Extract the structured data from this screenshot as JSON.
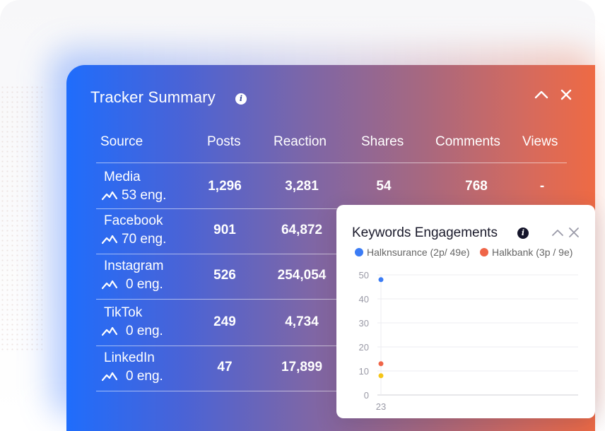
{
  "tracker": {
    "title": "Tracker Summary",
    "columns": [
      "Source",
      "Posts",
      "Reaction",
      "Shares",
      "Comments",
      "Views"
    ],
    "rows": [
      {
        "source": "Media",
        "eng": "53 eng.",
        "posts": "1,296",
        "reaction": "3,281",
        "shares": "54",
        "comments": "768",
        "views": "-"
      },
      {
        "source": "Facebook",
        "eng": "70 eng.",
        "posts": "901",
        "reaction": "64,872"
      },
      {
        "source": "Instagram",
        "eng": "0 eng.",
        "posts": "526",
        "reaction": "254,054"
      },
      {
        "source": "TikTok",
        "eng": "0 eng.",
        "posts": "249",
        "reaction": "4,734"
      },
      {
        "source": "LinkedIn",
        "eng": "0 eng.",
        "posts": "47",
        "reaction": "17,899"
      }
    ]
  },
  "keywords": {
    "title": "Keywords Engagements",
    "legend": [
      {
        "label": "Halknsurance (2p/ 49e)",
        "color": "#3b7cf5"
      },
      {
        "label": "Halkbank (3p / 9e)",
        "color": "#ef6548"
      }
    ]
  },
  "chart_data": {
    "type": "scatter",
    "title": "Keywords Engagements",
    "x_ticks": [
      "23"
    ],
    "y_ticks": [
      "0",
      "10",
      "20",
      "30",
      "40",
      "50"
    ],
    "ylim": [
      0,
      50
    ],
    "grid": true,
    "legend_position": "top",
    "series": [
      {
        "name": "Halknsurance (2p/ 49e)",
        "color": "#3b7cf5",
        "points": [
          {
            "x": "23",
            "y": 48
          }
        ]
      },
      {
        "name": "Halkbank (3p / 9e)",
        "color": "#ef6548",
        "points": [
          {
            "x": "23",
            "y": 13
          }
        ]
      },
      {
        "color": "#f5c518",
        "points": [
          {
            "x": "23",
            "y": 8
          }
        ]
      }
    ]
  },
  "icons": {
    "trend": "trend-line-icon",
    "info": "info-icon",
    "collapse": "chevron-up-icon",
    "close": "close-icon"
  }
}
